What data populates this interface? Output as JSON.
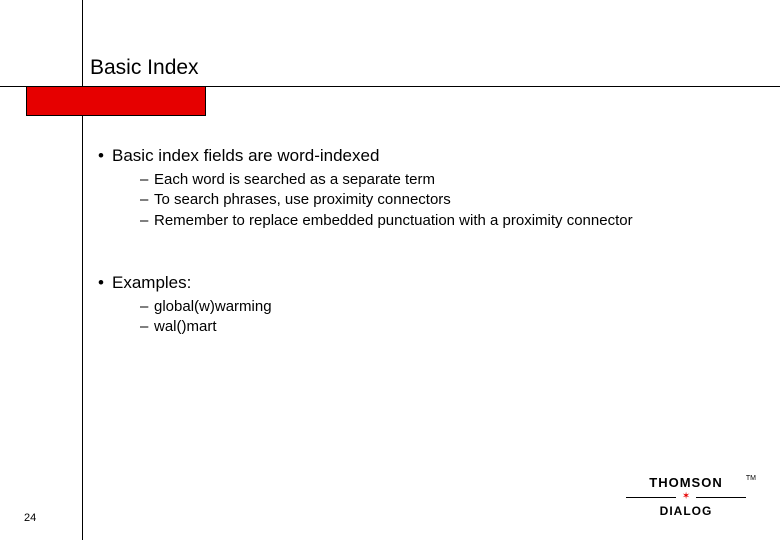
{
  "slide": {
    "title": "Basic Index",
    "page_number": "24"
  },
  "content": {
    "point1": {
      "text": "Basic index fields are word-indexed",
      "sub": [
        "Each word is searched as a separate term",
        "To search phrases, use proximity connectors",
        "Remember to replace embedded punctuation with a proximity connector"
      ]
    },
    "point2": {
      "text": "Examples:",
      "sub": [
        "global(w)warming",
        "wal()mart"
      ]
    }
  },
  "logo": {
    "top": "THOMSON",
    "bottom": "DIALOG",
    "tm": "TM"
  },
  "colors": {
    "accent": "#e60000"
  }
}
